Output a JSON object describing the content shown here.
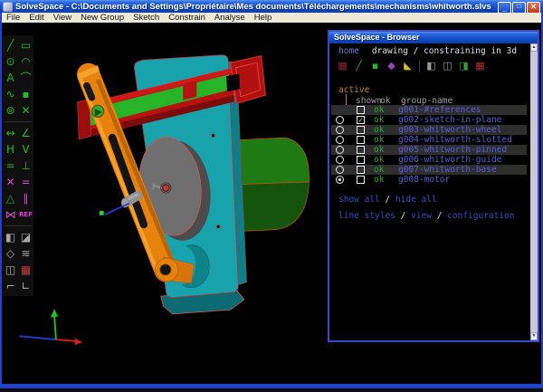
{
  "window": {
    "title": "SolveSpace - C:\\Documents and Settings\\Propriétaire\\Mes documents\\Téléchargements\\mechanisms\\whitworth.slvs",
    "menus": [
      "File",
      "Edit",
      "View",
      "New Group",
      "Sketch",
      "Constrain",
      "Analyse",
      "Help"
    ],
    "caption_buttons": {
      "minimize": "_",
      "maximize": "□",
      "close": "✕"
    }
  },
  "toolbar": {
    "items": [
      {
        "name": "line-tool-icon",
        "glyph": "╱",
        "cls": "g"
      },
      {
        "name": "rectangle-tool-icon",
        "glyph": "▭",
        "cls": "g"
      },
      {
        "name": "circle-tool-icon",
        "glyph": "⊙",
        "cls": "g"
      },
      {
        "name": "arc-tool-icon",
        "glyph": "◠",
        "cls": "g"
      },
      {
        "name": "text-tool-icon",
        "glyph": "A",
        "cls": "g"
      },
      {
        "name": "tangent-arc-tool-icon",
        "glyph": "⌒",
        "cls": "g"
      },
      {
        "name": "bezier-tool-icon",
        "glyph": "∿",
        "cls": "g"
      },
      {
        "name": "datum-point-tool-icon",
        "glyph": "▪",
        "cls": "g"
      },
      {
        "name": "construction-tool-icon",
        "glyph": "⊚",
        "cls": "g"
      },
      {
        "name": "split-curves-tool-icon",
        "glyph": "✕",
        "cls": "g"
      },
      {
        "sep": true
      },
      {
        "name": "distance-constraint-icon",
        "glyph": "↔",
        "cls": "g"
      },
      {
        "name": "angle-constraint-icon",
        "glyph": "∠",
        "cls": "g"
      },
      {
        "name": "horizontal-constraint-icon",
        "glyph": "H",
        "cls": "g"
      },
      {
        "name": "vertical-constraint-icon",
        "glyph": "V",
        "cls": "g"
      },
      {
        "name": "equal-constraint-icon",
        "glyph": "=",
        "cls": "g"
      },
      {
        "name": "perpendicular-constraint-icon",
        "glyph": "⊥",
        "cls": "g"
      },
      {
        "name": "point-on-constraint-icon",
        "glyph": "✕",
        "cls": "p"
      },
      {
        "name": "equal-length-constraint-icon",
        "glyph": "=",
        "cls": "p"
      },
      {
        "name": "oriented-same-constraint-icon",
        "glyph": "△",
        "cls": "g"
      },
      {
        "name": "parallel-constraint-icon",
        "glyph": "∥",
        "cls": "p"
      },
      {
        "name": "symmetric-constraint-icon",
        "glyph": "⋈",
        "cls": "p"
      },
      {
        "name": "reference-dimension-icon",
        "glyph": "REF",
        "cls": "m"
      },
      {
        "sep": true
      },
      {
        "name": "extrude-group-icon",
        "glyph": "◧",
        "cls": "gr"
      },
      {
        "name": "lathe-group-icon",
        "glyph": "◪",
        "cls": "gr"
      },
      {
        "name": "step-rotate-group-icon",
        "glyph": "◇",
        "cls": "gr"
      },
      {
        "name": "step-translate-group-icon",
        "glyph": "≋",
        "cls": "gr"
      },
      {
        "name": "sketch-in-workplane-icon",
        "glyph": "◫",
        "cls": "gr"
      },
      {
        "name": "activate-workplane-icon",
        "glyph": "▦",
        "cls": "rb"
      },
      {
        "name": "group-in-workplane-icon",
        "glyph": "⌐",
        "cls": "gr"
      },
      {
        "name": "group-in-3d-icon",
        "glyph": "∟",
        "cls": "gr"
      }
    ]
  },
  "browser": {
    "title": "SolveSpace - Browser",
    "home_label": "home",
    "context_label": "drawing / constraining in 3d",
    "view_icons": [
      {
        "name": "show-workplanes-icon",
        "glyph": "▦",
        "color": "#8b2438"
      },
      {
        "name": "show-normals-icon",
        "glyph": "╱",
        "color": "#2aa84a"
      },
      {
        "name": "show-points-icon",
        "glyph": "▪",
        "color": "#28b428"
      },
      {
        "name": "show-constraints-icon",
        "glyph": "◆",
        "color": "#a040c0"
      },
      {
        "name": "show-faces-icon",
        "glyph": "◣",
        "color": "#d8c020"
      },
      {
        "sep": true
      },
      {
        "name": "show-shaded-icon",
        "glyph": "◧",
        "color": "#9a9a9a"
      },
      {
        "name": "show-edges-icon",
        "glyph": "◫",
        "color": "#9a9a9a"
      },
      {
        "name": "show-outlines-icon",
        "glyph": "◨",
        "color": "#3a9a3a"
      },
      {
        "name": "show-mesh-icon",
        "glyph": "▦",
        "color": "#b03030"
      }
    ],
    "active_label": "active",
    "columns": {
      "shown": "shown",
      "ok": "ok",
      "group": "group-name"
    },
    "groups": [
      {
        "name": "g001-#references",
        "ok": "ok",
        "radio": false,
        "active": false,
        "shown": false,
        "striped": true
      },
      {
        "name": "g002-sketch-in-plane",
        "ok": "ok",
        "radio": true,
        "active": false,
        "shown": true,
        "striped": false
      },
      {
        "name": "g003-whitworth-wheel",
        "ok": "ok",
        "radio": true,
        "active": false,
        "shown": false,
        "striped": true
      },
      {
        "name": "g004-whitworth-slotted",
        "ok": "ok",
        "radio": true,
        "active": false,
        "shown": false,
        "striped": false
      },
      {
        "name": "g005-whitworth-pinned",
        "ok": "ok",
        "radio": true,
        "active": false,
        "shown": false,
        "striped": true
      },
      {
        "name": "g006-whitworth-guide",
        "ok": "ok",
        "radio": true,
        "active": false,
        "shown": false,
        "striped": false
      },
      {
        "name": "g007-whitworth-base",
        "ok": "ok",
        "radio": true,
        "active": false,
        "shown": false,
        "striped": true
      },
      {
        "name": "g008-motor",
        "ok": "ok",
        "radio": true,
        "active": true,
        "shown": false,
        "striped": false
      }
    ],
    "show_hide_links": [
      {
        "t": "show all",
        "link": true
      },
      {
        "t": " / ",
        "link": false
      },
      {
        "t": "hide all",
        "link": true
      }
    ],
    "config_links": [
      {
        "t": "line styles",
        "link": true
      },
      {
        "t": " / ",
        "link": false
      },
      {
        "t": "view",
        "link": true
      },
      {
        "t": " / ",
        "link": false
      },
      {
        "t": "configuration",
        "link": true
      }
    ]
  },
  "colors": {
    "active_orange": "#c8822a",
    "ok_green": "#35a035",
    "name_blue": "#5c5cd8",
    "link_blue": "#4646cc",
    "plate": "#17a2ac",
    "plate_dark": "#0e7f88",
    "base": "#0c6a72",
    "wheel": "#6f6f6f",
    "wheel_dark": "#4c4c4c",
    "rail": "#b61212",
    "rail_light": "#d01818",
    "rail_dark": "#7d0d0d",
    "slot_green": "#28b428",
    "motor": "#1e7a12",
    "motor_dark": "#14540c",
    "arm": "#e8820e",
    "arm_light": "#f8a02c",
    "arm_dark": "#b9650a",
    "pin_gray": "#919191",
    "edge_red": "#e83030",
    "axis_green": "#20c020",
    "axis_red": "#d42020",
    "axis_blue": "#2838d8",
    "vector_blue": "#2a35e8",
    "dot_green": "#28d828"
  }
}
